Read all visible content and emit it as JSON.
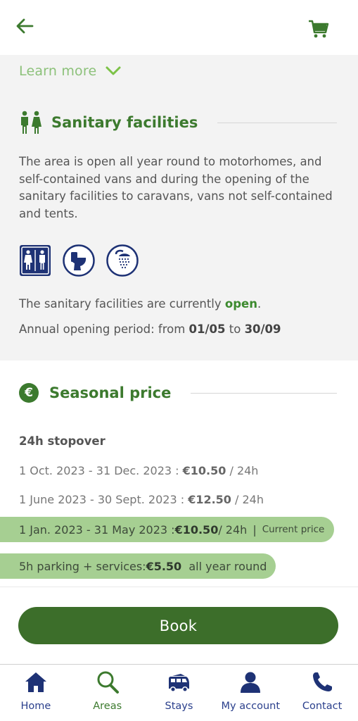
{
  "header": {
    "back_icon": "arrow-left-icon",
    "cart_icon": "cart-icon"
  },
  "learn_more": {
    "label": "Learn more",
    "icon": "chevron-down-icon"
  },
  "sanitary": {
    "title": "Sanitary facilities",
    "description": "The area is open all year round to motorhomes, and self-contained vans and during the opening of the sanitary facilities to caravans, vans not self-contained and tents.",
    "facility_icons": [
      "wc-icon",
      "toilet-icon",
      "shower-icon"
    ],
    "status_prefix": "The sanitary facilities are currently ",
    "status_value": "open",
    "status_suffix": ".",
    "period_prefix": "Annual opening period: from ",
    "period_from": "01/05",
    "period_mid": " to ",
    "period_to": "30/09"
  },
  "seasonal_price": {
    "title": "Seasonal price",
    "icon_glyph": "€",
    "stopover_label": "24h stopover",
    "rows": [
      {
        "period": "1 Oct. 2023 - 31 Dec. 2023 : ",
        "price": "€10.50",
        "unit": " / 24h"
      },
      {
        "period": "1 June 2023 - 30 Sept. 2023 : ",
        "price": "€12.50",
        "unit": " / 24h"
      }
    ],
    "current": {
      "period": "1 Jan. 2023 - 31 May 2023 : ",
      "price": "€10.50",
      "unit": " / 24h",
      "separator": "|",
      "tag": "Current price"
    },
    "parking": {
      "label": "5h parking + services: ",
      "price": "€5.50",
      "suffix": "  all year round"
    }
  },
  "book_button": "Book",
  "bottom_nav": {
    "items": [
      {
        "label": "Home",
        "icon": "home-icon"
      },
      {
        "label": "Areas",
        "icon": "search-icon"
      },
      {
        "label": "Stays",
        "icon": "campervan-icon"
      },
      {
        "label": "My account",
        "icon": "user-icon"
      },
      {
        "label": "Contact",
        "icon": "phone-icon"
      }
    ],
    "active": "Areas"
  },
  "colors": {
    "brand_green": "#3c7a2e",
    "button_green": "#3c6e2a",
    "highlight_green": "#a6cf92",
    "nav_blue": "#2a3f8c",
    "icon_navy": "#1e3275"
  }
}
